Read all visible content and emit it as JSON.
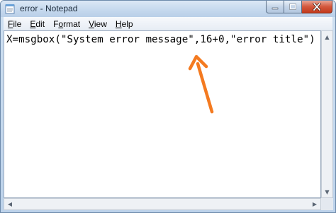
{
  "window": {
    "title": "error - Notepad"
  },
  "menu": {
    "items": [
      {
        "accel": "F",
        "rest": "ile"
      },
      {
        "accel": "E",
        "rest": "dit"
      },
      {
        "accel": "",
        "pre": "F",
        "acc2": "o",
        "rest": "rmat"
      },
      {
        "accel": "V",
        "rest": "iew"
      },
      {
        "accel": "H",
        "rest": "elp"
      }
    ]
  },
  "editor": {
    "content": "X=msgbox(\"System error message\",16+0,\"error title\")"
  },
  "icons": {
    "app": "notepad-icon",
    "minimize": "minimize-icon",
    "maximize": "maximize-icon",
    "close": "close-icon"
  },
  "colors": {
    "annotation_arrow": "#f47a20"
  }
}
